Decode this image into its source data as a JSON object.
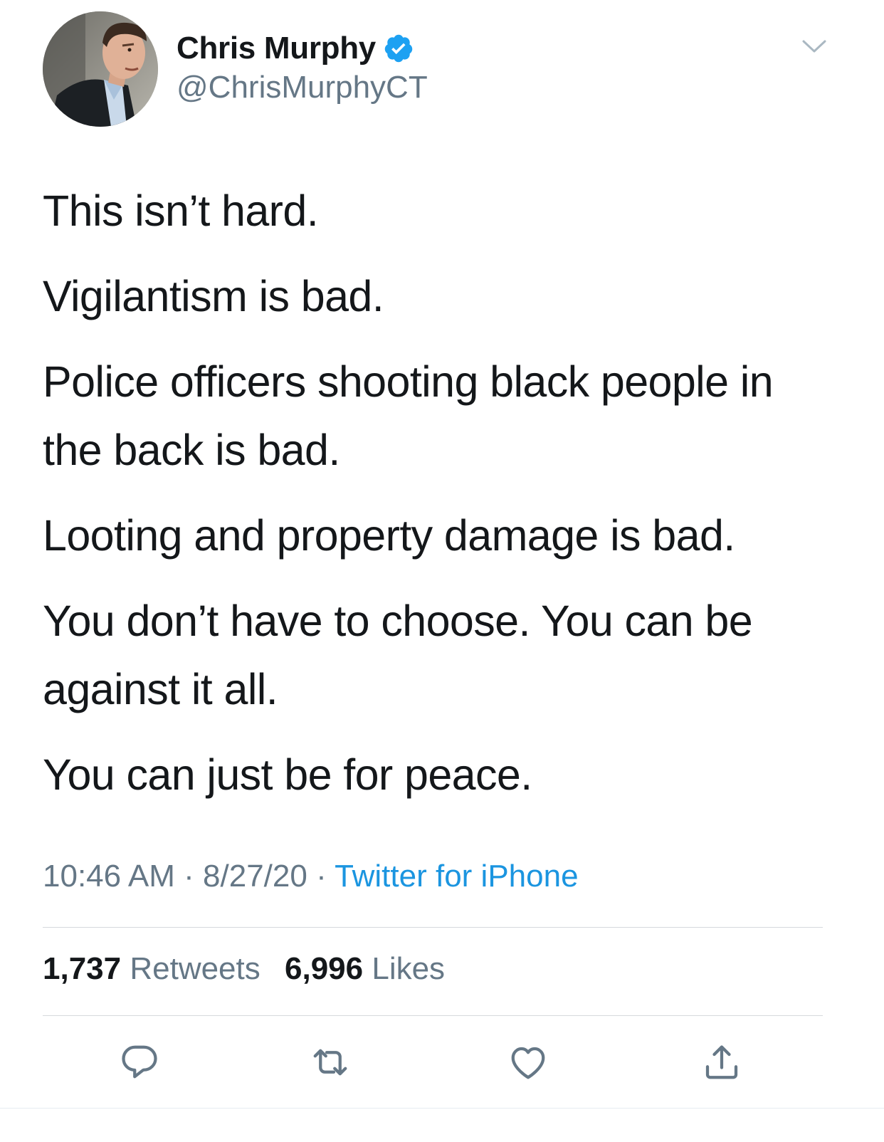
{
  "author": {
    "display_name": "Chris Murphy",
    "handle": "@ChrisMurphyCT",
    "verified": true
  },
  "tweet": {
    "paragraphs": [
      "This isn’t hard.",
      "Vigilantism is bad.",
      "Police officers shooting black people in the back is bad.",
      "Looting and property damage is bad.",
      "You don’t have to choose. You can be against it all.",
      "You can just be for peace."
    ],
    "time": "10:46 AM",
    "separator": "·",
    "date": "8/27/20",
    "source": "Twitter for iPhone"
  },
  "stats": {
    "retweets_count": "1,737",
    "retweets_label": "Retweets",
    "likes_count": "6,996",
    "likes_label": "Likes"
  },
  "icons": {
    "reply": "reply-icon",
    "retweet": "retweet-icon",
    "like": "heart-icon",
    "share": "share-icon",
    "verified": "verified-badge-icon",
    "more": "chevron-down-icon"
  },
  "colors": {
    "text_primary": "#14171a",
    "text_secondary": "#657786",
    "link": "#1b95e0",
    "verified": "#1da1f2"
  }
}
